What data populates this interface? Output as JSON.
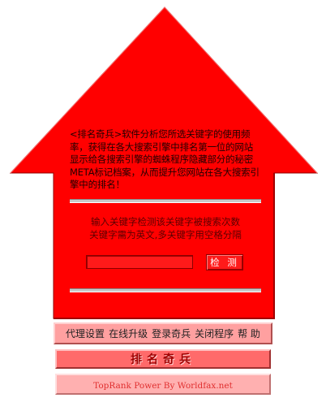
{
  "description": "<排名奇兵>软件分析您所选关键字的使用频率，获得在各大搜索引擎中排名第一位的网站显示给各搜索引擎的蜘蛛程序隐藏部分的秘密META标记档案，从而提升您网站在各大搜索引擎中的排名！",
  "hint": {
    "line1": "输入关键字检测该关键字被搜索次数",
    "line2": "关键字需为英文,多关键字用空格分隔"
  },
  "search": {
    "value": "",
    "button_label": "检 测"
  },
  "menu": {
    "items": [
      {
        "label": "代理设置"
      },
      {
        "label": "在线升级"
      },
      {
        "label": "登录奇兵"
      },
      {
        "label": "关闭程序"
      },
      {
        "label": "帮 助"
      }
    ]
  },
  "logo": {
    "text": "排名奇兵"
  },
  "credit": {
    "text": "TopRank Power By Worldfax.net"
  },
  "colors": {
    "arrow": "#ff0000",
    "menu_bg": "#ffa0a0",
    "logo_bg": "#ff6a6a",
    "credit_bg": "#ffb0b0"
  }
}
